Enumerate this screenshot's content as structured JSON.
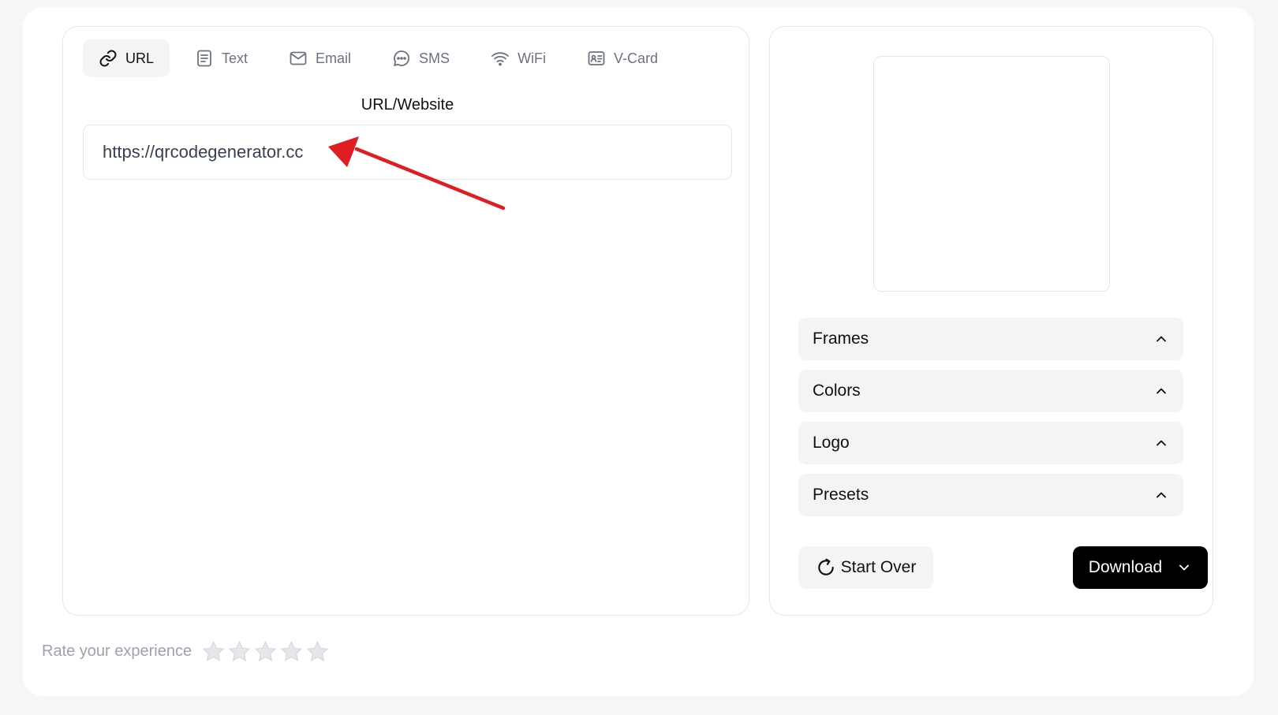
{
  "tabs": [
    {
      "label": "URL",
      "icon": "link-icon",
      "active": true
    },
    {
      "label": "Text",
      "icon": "document-icon",
      "active": false
    },
    {
      "label": "Email",
      "icon": "mail-icon",
      "active": false
    },
    {
      "label": "SMS",
      "icon": "chat-bubble-icon",
      "active": false
    },
    {
      "label": "WiFi",
      "icon": "wifi-icon",
      "active": false
    },
    {
      "label": "V-Card",
      "icon": "contact-card-icon",
      "active": false
    }
  ],
  "form": {
    "label": "URL/Website",
    "url_value": "https://qrcodegenerator.cc"
  },
  "annotation": {
    "arrow_color": "#e11d24",
    "arrow_icon": "red-arrow-icon"
  },
  "options": {
    "frames": "Frames",
    "colors": "Colors",
    "logo": "Logo",
    "presets": "Presets"
  },
  "actions": {
    "start_over": "Start Over",
    "download": "Download"
  },
  "rating": {
    "label": "Rate your experience",
    "stars_total": 5,
    "stars_selected": 0
  }
}
